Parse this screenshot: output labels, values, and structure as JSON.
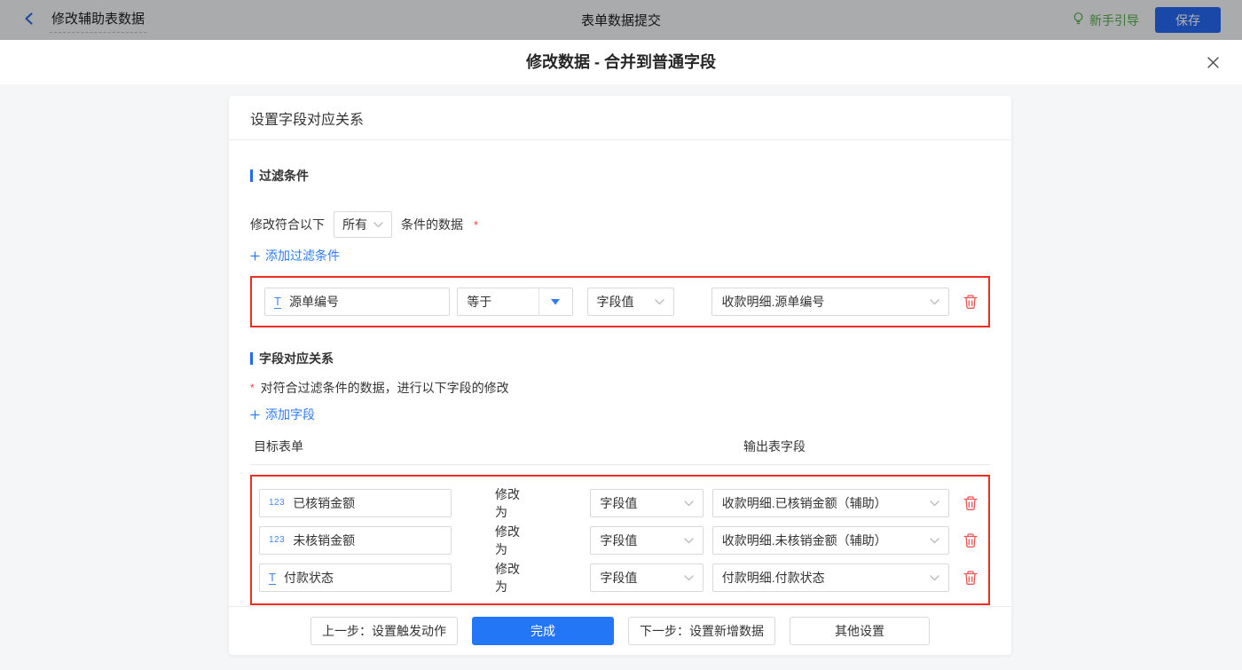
{
  "colors": {
    "primary_blue": "#2468f2",
    "link_blue": "#2f7cf6",
    "field_icon_blue": "#4086f8",
    "highlight_red": "#ee2c1f",
    "trash_red": "#f15553",
    "required_red": "#f53f3f",
    "guide_green": "#54ad48"
  },
  "topbar": {
    "back_title": "修改辅助表数据",
    "center_title": "表单数据提交",
    "guide_label": "新手引导",
    "save_label": "保存"
  },
  "dialog": {
    "title": "修改数据 - 合并到普通字段"
  },
  "panel": {
    "header": "设置字段对应关系",
    "filter": {
      "section_title": "过滤条件",
      "match_prefix": "修改符合以下",
      "match_value": "所有",
      "match_suffix": "条件的数据",
      "required_mark": "*",
      "add_label": "添加过滤条件",
      "row": {
        "type_glyph": "T",
        "field": "源单编号",
        "operator": "等于",
        "value_type": "字段值",
        "value": "收款明细.源单编号"
      }
    },
    "mapping": {
      "section_title": "字段对应关系",
      "required_mark": "*",
      "note": "对符合过滤条件的数据，进行以下字段的修改",
      "add_label": "添加字段",
      "columns": {
        "target": "目标表单",
        "output": "输出表字段"
      },
      "modify_label": "修改为",
      "rows": [
        {
          "type_glyph": "123",
          "field": "已核销金额",
          "value_type": "字段值",
          "value": "收款明细.已核销金额（辅助）"
        },
        {
          "type_glyph": "123",
          "field": "未核销金额",
          "value_type": "字段值",
          "value": "收款明细.未核销金额（辅助）"
        },
        {
          "type_glyph": "T",
          "field": "付款状态",
          "value_type": "字段值",
          "value": "付款明细.付款状态"
        }
      ]
    },
    "footer": {
      "prev": "上一步：设置触发动作",
      "done": "完成",
      "next": "下一步：设置新增数据",
      "other": "其他设置"
    }
  }
}
